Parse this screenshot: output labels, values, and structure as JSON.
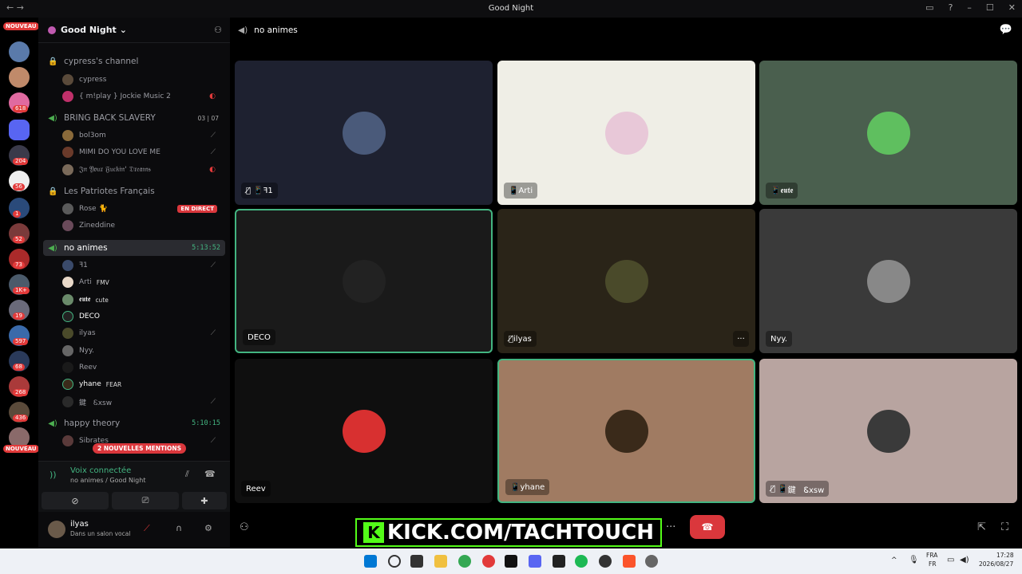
{
  "window": {
    "title": "Good Night",
    "nav": "← →",
    "controls": [
      "▭",
      "?",
      "–",
      "☐",
      "✕"
    ]
  },
  "servers": {
    "nouveau_top": "NOUVEAU",
    "nouveau_bottom": "NOUVEAU",
    "badges": [
      "618",
      "204",
      "56",
      "1",
      "52",
      "73",
      "1K+",
      "19",
      "597",
      "68",
      "268",
      "436"
    ]
  },
  "guild": {
    "name": "Good Night",
    "chevron": "⌄"
  },
  "channels": [
    {
      "name": "cypress's channel",
      "type": "locked"
    },
    {
      "name": "BRING BACK SLAVERY",
      "type": "voice",
      "count_left": "03",
      "count_right": "07"
    },
    {
      "name": "Les Patriotes Français",
      "type": "locked",
      "live": "EN DIRECT"
    },
    {
      "name": "no animes",
      "type": "voice",
      "timer": "5:13:52",
      "active": true
    },
    {
      "name": "happy theory",
      "type": "voice",
      "timer": "5:10:15"
    }
  ],
  "members": {
    "cypress": [
      {
        "name": "cypress",
        "color": "#5a4a3a"
      },
      {
        "name": "{ m!play } Jockie Music 2",
        "color": "#c0306a",
        "icon": "red"
      }
    ],
    "bring": [
      {
        "name": "bol3om",
        "color": "#8a6a3a",
        "icon": "mute"
      },
      {
        "name": "MIMI DO YOU LOVE ME",
        "color": "#6a3a2a",
        "icon": "mute"
      },
      {
        "name": "𝔍𝔫 𝔜𝔬𝔲𝔯 𝔉𝔲𝔠𝔨𝔦𝔫' 𝔇𝔯𝔢𝔞𝔪𝔰",
        "color": "#7a6a5a",
        "icon": "red"
      }
    ],
    "patriotes": [
      {
        "name": "Rose 🐈",
        "color": "#5a5a5a"
      },
      {
        "name": "Zineddine",
        "color": "#6a4a5a"
      }
    ],
    "noanimes": [
      {
        "name": "ꟻ1",
        "color": "#3a4a6a",
        "icon": "mute"
      },
      {
        "name": "Arti",
        "color": "#e8d8c8",
        "tag": "FMV"
      },
      {
        "name": "𝖊𝖚𝖙𝖊",
        "color": "#6a8a6a",
        "tag": "cute",
        "hi": true
      },
      {
        "name": "DECO",
        "color": "#222222",
        "hi": true
      },
      {
        "name": "ilyas",
        "color": "#4a4a2a",
        "icon": "mute"
      },
      {
        "name": "Nyy.",
        "color": "#666666"
      },
      {
        "name": "Reev",
        "color": "#1a1a1a"
      },
      {
        "name": "yhane",
        "color": "#3a2a1a",
        "tag": "FEAR",
        "hi": true
      },
      {
        "name": "鍵　Ꮛxsw",
        "color": "#2a2a2a",
        "icon": "mute"
      }
    ],
    "happy": [
      {
        "name": "Sibrates",
        "color": "#5a3a3a",
        "icon": "mute"
      }
    ]
  },
  "mentions_badge": "2 NOUVELLES MENTIONS",
  "voice_panel": {
    "status": "Voix connectée",
    "location": "no animes / Good Night"
  },
  "user_panel": {
    "name": "ilyas",
    "status": "Dans un salon vocal"
  },
  "stage": {
    "channel_name": "no animes",
    "tiles": [
      {
        "label": "ꟻ1",
        "prefix": "🎙̸ 📱 ",
        "bg": "#1e2130",
        "avatar": "#4a5a7a"
      },
      {
        "label": "Arti",
        "prefix": "📱 ",
        "bg": "#efeee6",
        "avatar": "#e8c8d8"
      },
      {
        "label": "𝖊𝖚𝖙𝖊",
        "prefix": "📱 ",
        "bg": "#4a5f4e",
        "avatar": "#5fbf5f"
      },
      {
        "label": "DECO",
        "prefix": "",
        "bg": "#1a1a1a",
        "avatar": "#222222",
        "speaking": true
      },
      {
        "label": "ilyas",
        "prefix": "🎙̸ ",
        "bg": "#2a2418",
        "avatar": "#4a4a2a",
        "more": "···"
      },
      {
        "label": "Nyy.",
        "prefix": "",
        "bg": "#3a3a3a",
        "avatar": "#888888"
      },
      {
        "label": "Reev",
        "prefix": "",
        "bg": "#0f0f0f",
        "avatar": "#d83030"
      },
      {
        "label": "yhane",
        "prefix": "📱 ",
        "bg": "#a07b62",
        "avatar": "#3a2a1a",
        "speaking": true
      },
      {
        "label": "鍵　Ꮛxsw",
        "prefix": "🎙̸ 📱 ",
        "bg": "#b8a4a0",
        "avatar": "#3a3a3a"
      }
    ]
  },
  "overlay_text": "KICK.COM/TACHTOUCH",
  "taskbar": {
    "lang_top": "FRA",
    "lang_bottom": "FR",
    "time": "17:28",
    "date": "2026/08/27"
  }
}
